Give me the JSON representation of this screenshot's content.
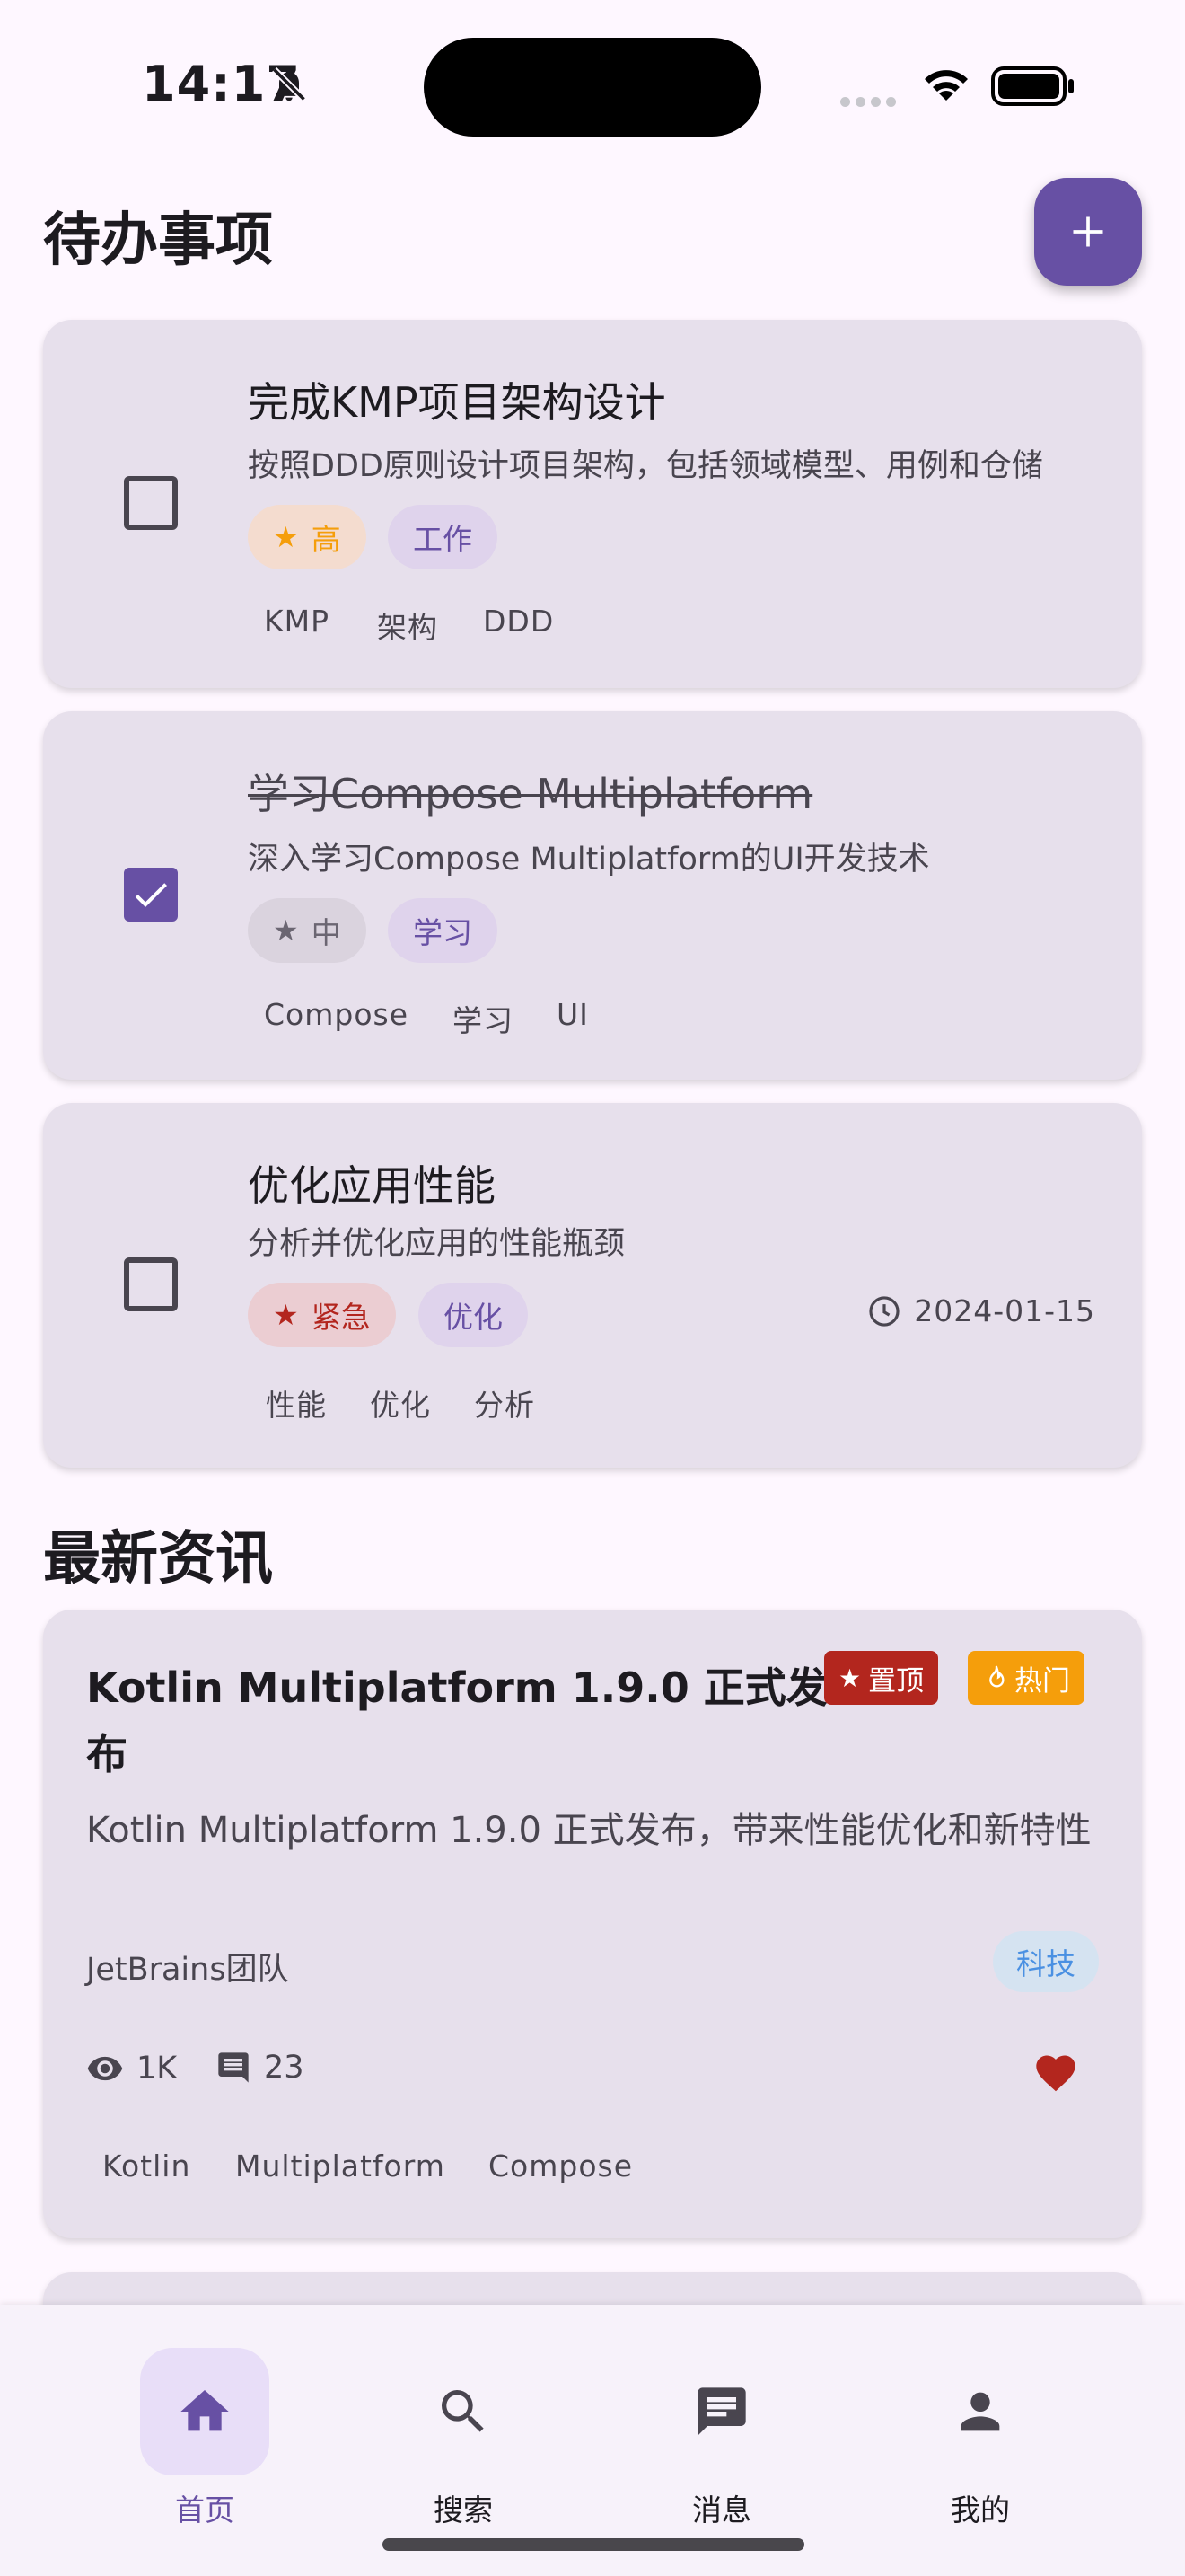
{
  "status_bar": {
    "time": "14:17"
  },
  "todo": {
    "section_title": "待办事项",
    "add_label": "+",
    "items": [
      {
        "title": "完成KMP项目架构设计",
        "description": "按照DDD原则设计项目架构，包括领域模型、用例和仓储",
        "completed": false,
        "priority": "高",
        "category": "工作",
        "tags": [
          "KMP",
          "架构",
          "DDD"
        ],
        "due_date": ""
      },
      {
        "title": "学习Compose Multiplatform",
        "description": "深入学习Compose Multiplatform的UI开发技术",
        "completed": true,
        "priority": "中",
        "category": "学习",
        "tags": [
          "Compose",
          "学习",
          "UI"
        ],
        "due_date": ""
      },
      {
        "title": "优化应用性能",
        "description": "分析并优化应用的性能瓶颈",
        "completed": false,
        "priority": "紧急",
        "category": "优化",
        "tags": [
          "性能",
          "优化",
          "分析"
        ],
        "due_date": "2024-01-15"
      }
    ]
  },
  "news": {
    "section_title": "最新资讯",
    "items": [
      {
        "title": "Kotlin Multiplatform 1.9.0 正式发布",
        "badge_pinned": "置顶",
        "badge_hot": "热门",
        "summary": "Kotlin Multiplatform 1.9.0 正式发布，带来性能优化和新特性",
        "author": "JetBrains团队",
        "category": "科技",
        "views": "1K",
        "comments": "23",
        "liked": true,
        "tags": [
          "Kotlin",
          "Multiplatform",
          "Compose"
        ]
      }
    ]
  },
  "bottom_nav": {
    "items": [
      {
        "label": "首页",
        "icon": "home-icon",
        "active": true
      },
      {
        "label": "搜索",
        "icon": "search-icon",
        "active": false
      },
      {
        "label": "消息",
        "icon": "message-icon",
        "active": false
      },
      {
        "label": "我的",
        "icon": "person-icon",
        "active": false
      }
    ]
  },
  "colors": {
    "primary": "#6750A4",
    "background": "#FEF7FF",
    "card": "#E7E0EC",
    "priority_high": "#F59E0B",
    "priority_urgent": "#B3261E",
    "badge_pinned": "#B3261E",
    "badge_hot": "#F59E0B",
    "category_tech": "#4A90E2"
  }
}
